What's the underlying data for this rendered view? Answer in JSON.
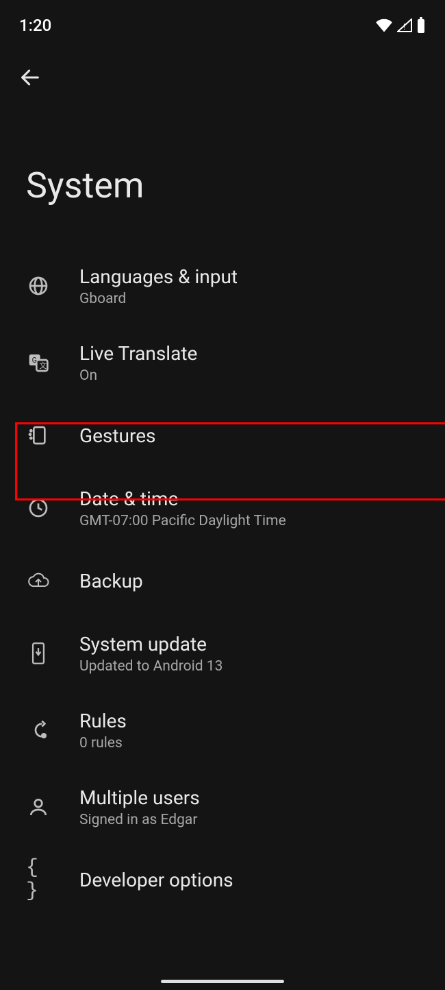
{
  "status": {
    "time": "1:20"
  },
  "page": {
    "title": "System"
  },
  "items": [
    {
      "icon": "globe",
      "title": "Languages & input",
      "sub": "Gboard"
    },
    {
      "icon": "translate",
      "title": "Live Translate",
      "sub": "On"
    },
    {
      "icon": "gesture",
      "title": "Gestures",
      "sub": ""
    },
    {
      "icon": "clock",
      "title": "Date & time",
      "sub": "GMT-07:00 Pacific Daylight Time"
    },
    {
      "icon": "cloud-up",
      "title": "Backup",
      "sub": ""
    },
    {
      "icon": "phone-down",
      "title": "System update",
      "sub": "Updated to Android 13"
    },
    {
      "icon": "rules",
      "title": "Rules",
      "sub": "0 rules"
    },
    {
      "icon": "person",
      "title": "Multiple users",
      "sub": "Signed in as Edgar"
    },
    {
      "icon": "braces",
      "title": "Developer options",
      "sub": ""
    }
  ],
  "highlighted_index": 2
}
